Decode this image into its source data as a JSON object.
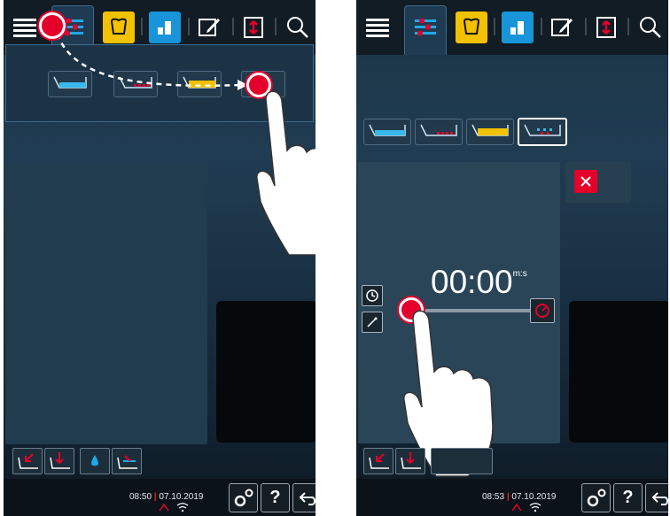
{
  "screen_before": {
    "status": {
      "time": "08:50",
      "date": "07.10.2019"
    },
    "bottom_buttons": {
      "help_label": "?"
    }
  },
  "screen_after": {
    "timer": {
      "value": "00:00",
      "unit": "m:s"
    },
    "status": {
      "time": "08:53",
      "date": "07.10.2019"
    },
    "bottom_buttons": {
      "help_label": "?"
    }
  },
  "colors": {
    "accent_red": "#e4002b",
    "yellow": "#f2c100",
    "blue": "#1795d8",
    "bar": "#121c24"
  },
  "icons": [
    "menu-icon",
    "cooking-modes-icon",
    "intelligent-cooking-icon",
    "program-icon",
    "edit-icon",
    "shift-icon",
    "search-icon",
    "settings-icon",
    "back-icon"
  ]
}
